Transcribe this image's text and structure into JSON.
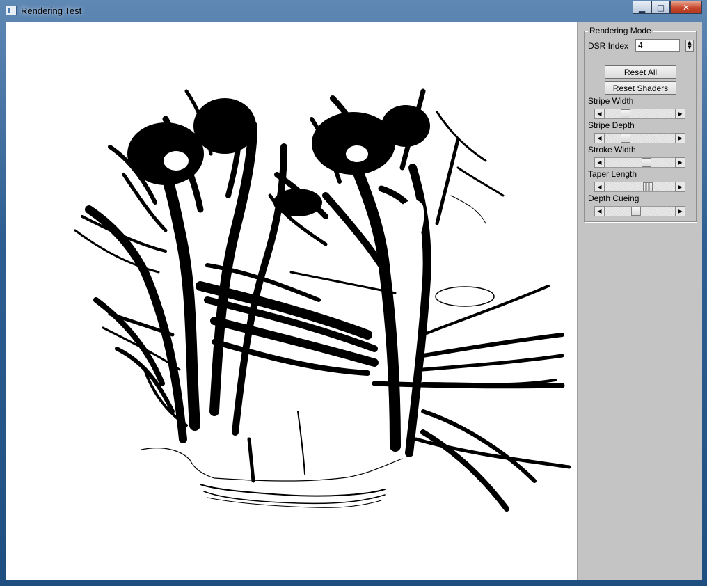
{
  "window": {
    "title": "Rendering Test"
  },
  "caption_buttons": {
    "minimize": "▁",
    "maximize": "□",
    "close": "✕"
  },
  "panel": {
    "group_title": "Rendering Mode",
    "dsr_label": "DSR Index",
    "dsr_value": "4",
    "reset_all": "Reset All",
    "reset_shaders": "Reset Shaders",
    "sliders": [
      {
        "label": "Stripe Width",
        "value": 0.25
      },
      {
        "label": "Stripe Depth",
        "value": 0.25
      },
      {
        "label": "Stroke Width",
        "value": 0.62
      },
      {
        "label": "Taper Length",
        "value": 0.62
      },
      {
        "label": "Depth Cueing",
        "value": 0.5
      }
    ]
  }
}
